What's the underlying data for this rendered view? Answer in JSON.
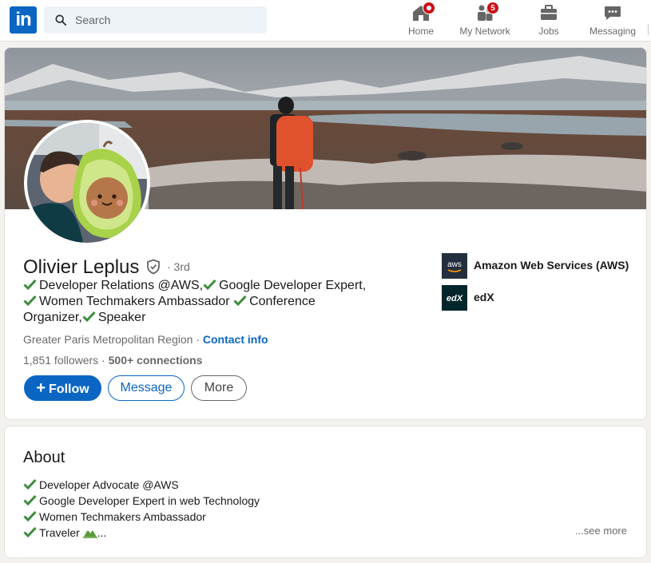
{
  "nav": {
    "logo": "in",
    "search_placeholder": "Search",
    "items": [
      {
        "label": "Home",
        "badge": "",
        "icon": "home-icon"
      },
      {
        "label": "My Network",
        "badge": "5",
        "icon": "network-icon"
      },
      {
        "label": "Jobs",
        "badge": "",
        "icon": "briefcase-icon"
      },
      {
        "label": "Messaging",
        "badge": "",
        "icon": "messaging-icon"
      }
    ]
  },
  "profile": {
    "name": "Olivier Leplus",
    "degree": "· 3rd",
    "headline_parts": [
      "Developer Relations @AWS,",
      "Google Developer Expert,",
      "Women Techmakers Ambassador",
      "Conference Organizer,",
      "Speaker"
    ],
    "location": "Greater Paris Metropolitan Region",
    "separator": " · ",
    "contact_info": "Contact info",
    "followers": "1,851 followers",
    "connections": "500+ connections",
    "dot": " · ",
    "buttons": {
      "follow": "Follow",
      "message": "Message",
      "more": "More"
    },
    "companies": [
      {
        "name": "Amazon Web Services (AWS)",
        "logo_text": "aws"
      },
      {
        "name": "edX",
        "logo_text": "edX"
      }
    ]
  },
  "about": {
    "title": "About",
    "lines": [
      "Developer Advocate @AWS",
      "Google Developer Expert in web Technology",
      "Women Techmakers Ambassador",
      "Traveler"
    ],
    "trailing": "...",
    "see_more": "...see more"
  },
  "colors": {
    "brand": "#0a66c2",
    "badge": "#cc1016",
    "check": "#3b8d3b"
  }
}
